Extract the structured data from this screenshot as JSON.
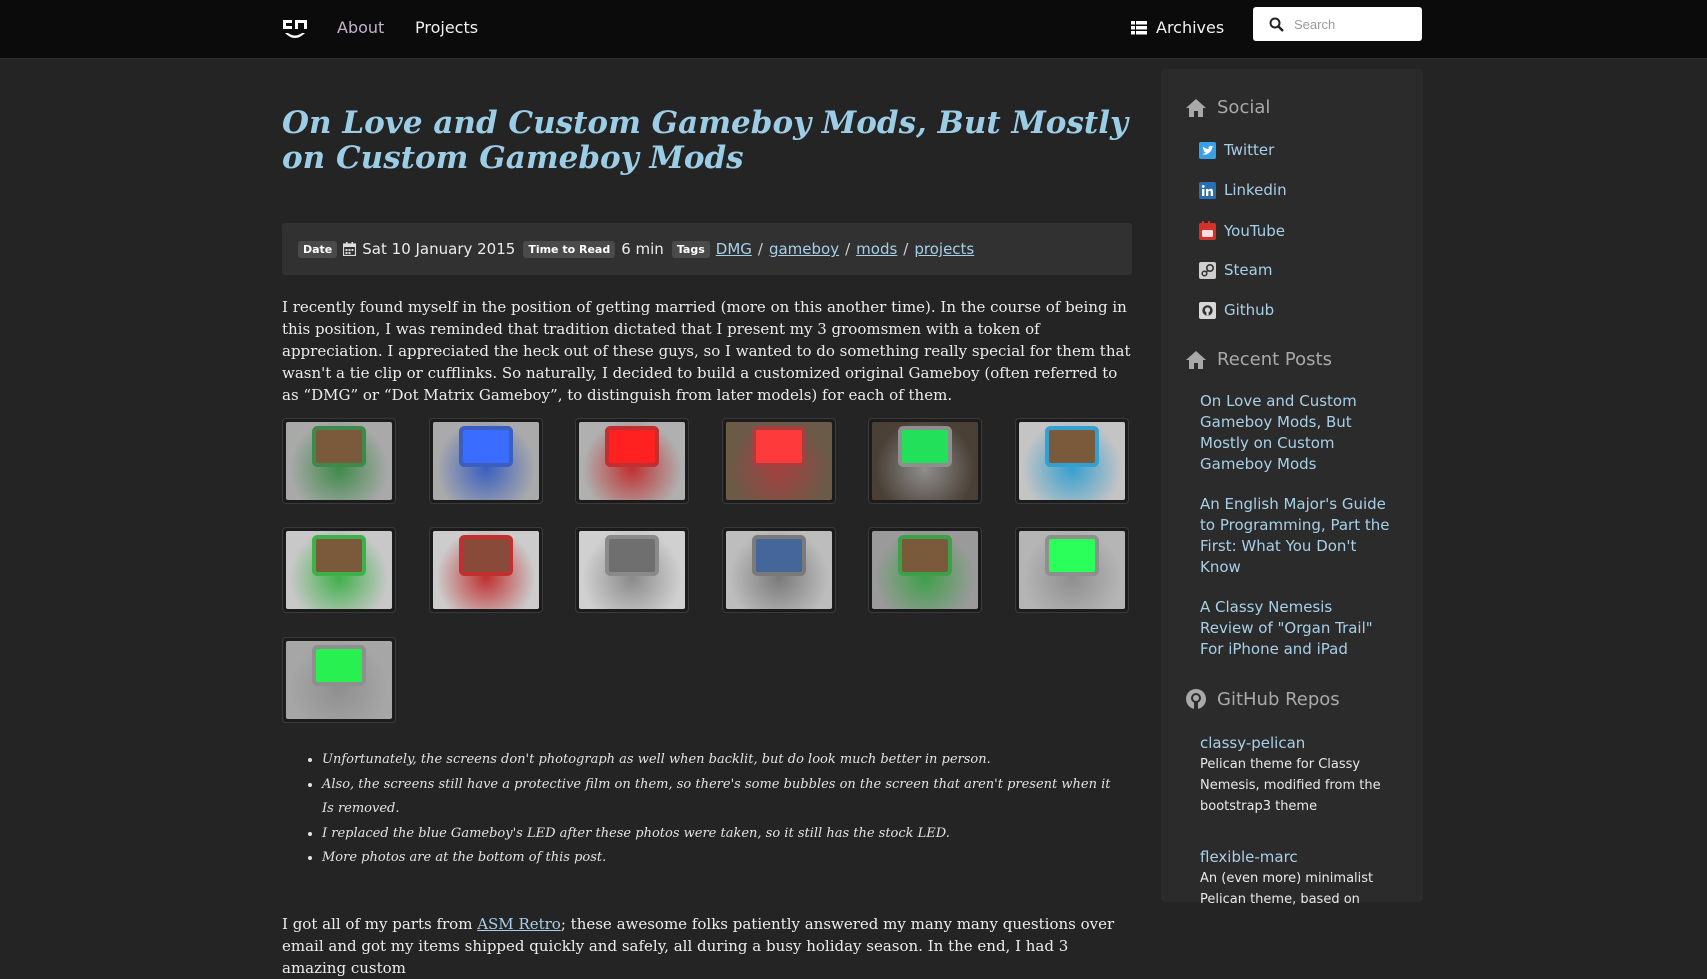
{
  "nav": {
    "about": "About",
    "projects": "Projects",
    "archives": "Archives",
    "search_placeholder": "Search"
  },
  "post": {
    "title": "On Love and Custom Gameboy Mods, But Mostly on Custom Gameboy Mods",
    "meta": {
      "date_label": "Date",
      "date": "Sat 10 January 2015",
      "ttr_label": "Time to Read",
      "ttr": "6 min",
      "tags_label": "Tags",
      "tags": [
        "DMG",
        "gameboy",
        "mods",
        "projects"
      ],
      "tag_sep": "/"
    },
    "intro": "I recently found myself in the position of getting married (more on this another time). In the course of being in this position, I was reminded that tradition dictated that I present my 3 groomsmen with a token of appreciation. I appreciated the heck out of these guys, so I wanted to do something really special for them that wasn't a tie clip or cufflinks. So naturally, I decided to build a customized original Gameboy (often referred to as “DMG” or “Dot Matrix Gameboy”, to distinguish from later models) for each of them.",
    "gallery": [
      {
        "screen": "#7a5a3a",
        "shell": "#3f8a4a",
        "bg": "#a9a9a9"
      },
      {
        "screen": "#3a6cff",
        "shell": "#3a5fc0",
        "bg": "#aaaaaa"
      },
      {
        "screen": "#ff2020",
        "shell": "#c03030",
        "bg": "#b0b0b0"
      },
      {
        "screen": "#ff3a3a",
        "shell": "#a54040",
        "bg": "#6b5a48"
      },
      {
        "screen": "#22e05a",
        "shell": "#8f8f8f",
        "bg": "#4a4036"
      },
      {
        "screen": "#7a5a3a",
        "shell": "#35a0d0",
        "bg": "#c4c4c4"
      },
      {
        "screen": "#7a5a3a",
        "shell": "#3fb04a",
        "bg": "#c8c8c8"
      },
      {
        "screen": "#8a4a3a",
        "shell": "#c03030",
        "bg": "#cccccc"
      },
      {
        "screen": "#6f6f6f",
        "shell": "#8a8a8a",
        "bg": "#d0d0d0"
      },
      {
        "screen": "#446699",
        "shell": "#7a7a7a",
        "bg": "#bdbdbd"
      },
      {
        "screen": "#7a5a3a",
        "shell": "#3fa04a",
        "bg": "#9a9a9a"
      },
      {
        "screen": "#2aff5a",
        "shell": "#8f8f8f",
        "bg": "#b5b5b5"
      },
      {
        "screen": "#28f050",
        "shell": "#8f8f8f",
        "bg": "#a6a6a6"
      }
    ],
    "notes": [
      "Unfortunately, the screens don't photograph as well when backlit, but do look much better in person.",
      "Also, the screens still have a protective film on them, so there's some bubbles on the screen that aren't present when it Is removed.",
      "I replaced the blue Gameboy's LED after these photos were taken, so it still has the stock LED.",
      "More photos are at the bottom of this post."
    ],
    "body2_prefix": "I got all of my parts from ",
    "body2_link": "ASM Retro",
    "body2_suffix": "; these awesome folks patiently answered my many many questions over email and got my items shipped quickly and safely, all during a busy holiday season. In the end, I had 3 amazing custom"
  },
  "sidebar": {
    "social_title": "Social",
    "social": [
      {
        "label": "Twitter",
        "color": "#3aa0e6"
      },
      {
        "label": "Linkedin",
        "color": "#2b6fb3"
      },
      {
        "label": "YouTube",
        "color": "#d3322b"
      },
      {
        "label": "Steam",
        "color": "#cfcfcf"
      },
      {
        "label": "Github",
        "color": "#d8d8d8"
      }
    ],
    "recent_title": "Recent Posts",
    "recent": [
      "On Love and Custom Gameboy Mods, But Mostly on Custom Gameboy Mods",
      "An English Major's Guide to Programming, Part the First: What You Don't Know",
      "A Classy Nemesis Review of \"Organ Trail\" For iPhone and iPad"
    ],
    "repos_title": "GitHub Repos",
    "repos": [
      {
        "name": "classy-pelican",
        "desc": "Pelican theme for Classy Nemesis, modified from the bootstrap3 theme"
      },
      {
        "name": "flexible-marc",
        "desc": "An (even more) minimalist Pelican theme, based on"
      }
    ]
  }
}
